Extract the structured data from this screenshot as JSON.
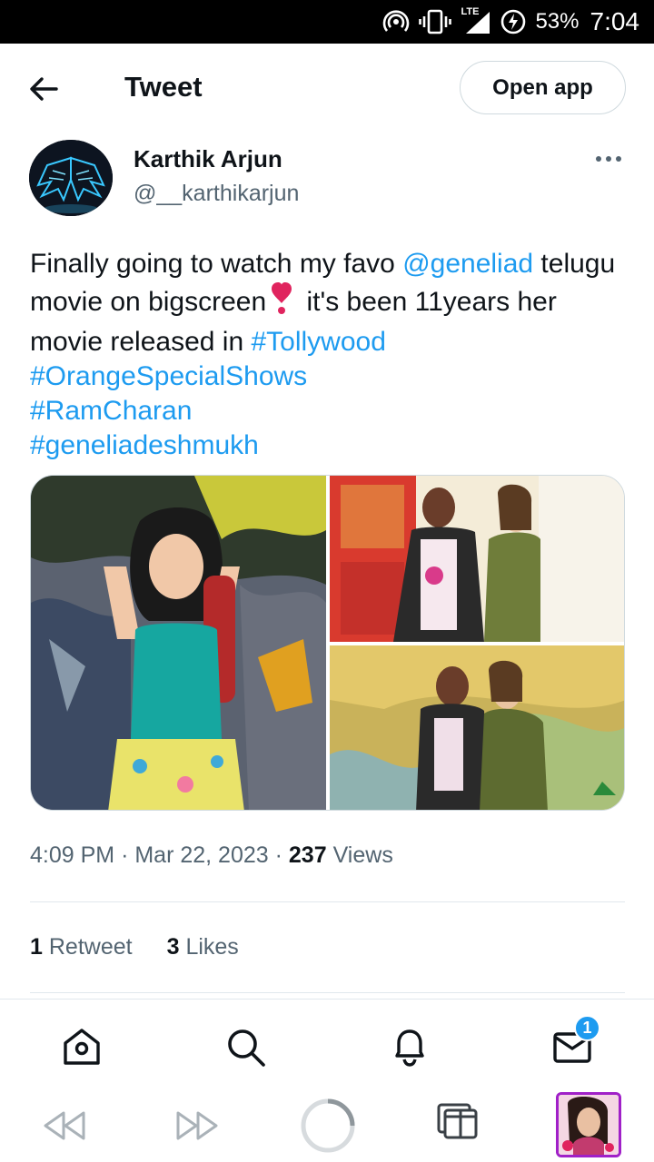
{
  "status_bar": {
    "network": "LTE",
    "battery": "53%",
    "time": "7:04",
    "icons": [
      "hotspot-icon",
      "vibrate-icon",
      "signal-icon",
      "battery-charging-icon"
    ]
  },
  "header": {
    "title": "Tweet",
    "open_app_label": "Open app",
    "back_icon": "arrow-left-icon"
  },
  "tweet": {
    "author_name": "Karthik Arjun",
    "author_handle": "@__karthikarjun",
    "text": {
      "part1": "Finally going to watch my favo ",
      "mention": "@geneliad",
      "part2": " telugu movie on bigscreen",
      "part3": " it's been 11years her movie released in ",
      "hashtag1": "#Tollywood",
      "hashtag2": "#OrangeSpecialShows",
      "hashtag3": "#RamCharan",
      "hashtag4": "#geneliadeshmukh"
    },
    "time": "4:09 PM",
    "date": "Mar 22, 2023",
    "separator": "·",
    "views_count": "237",
    "views_label": "Views",
    "retweets_count": "1",
    "retweets_label": "Retweet",
    "likes_count": "3",
    "likes_label": "Likes"
  },
  "bottom_nav": {
    "items": [
      "home-icon",
      "search-icon",
      "notifications-icon",
      "messages-icon"
    ],
    "messages_badge": "1"
  },
  "browser_toolbar": {
    "items": [
      "rewind-icon",
      "fast-forward-icon",
      "loading-spinner-icon",
      "tabs-icon",
      "tab-thumbnail"
    ]
  },
  "colors": {
    "accent": "#1d9bf0",
    "text": "#0f1419",
    "secondary": "#536471",
    "border": "#cfd9de",
    "heart": "#e0245e",
    "thumb_border": "#a020c8"
  }
}
